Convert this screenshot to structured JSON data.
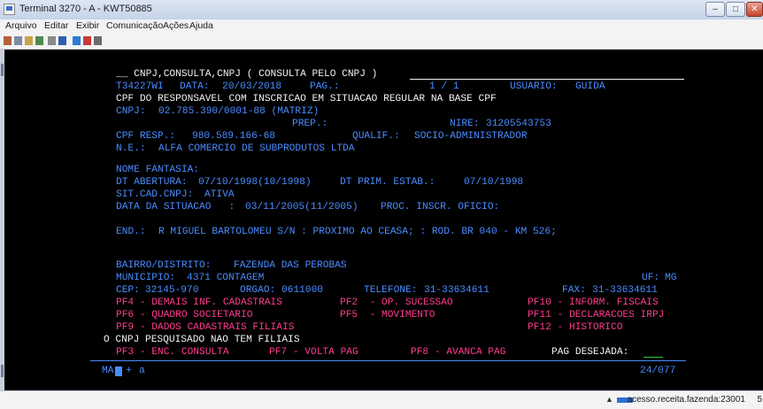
{
  "window": {
    "title": "Terminal 3270 - A - KWT50885",
    "min": "–",
    "max": "□",
    "close": "✕"
  },
  "menu": [
    "Arquivo",
    "Editar",
    "Exibir",
    "Comunicação",
    "Ações",
    "Ajuda"
  ],
  "toolbar_icons": [
    "new-session-icon",
    "copy-icon",
    "paste-icon",
    "print-icon",
    "settings-icon",
    "record-icon",
    "connect-icon",
    "disconnect-icon",
    "macro-icon"
  ],
  "terminal": {
    "header": "__ CNPJ,CONSULTA,CNPJ ( CONSULTA PELO CNPJ )",
    "trans": "T34227WI",
    "data_label": "DATA:",
    "data": "20/03/2018",
    "pag_label": "PAG.:",
    "pag": "1 / 1",
    "usuario_label": "USUARIO:",
    "usuario": "GUIDA",
    "msg": "CPF DO RESPONSAVEL COM INSCRICAO EM SITUACAO REGULAR NA BASE CPF",
    "cnpj_label": "CNPJ:",
    "cnpj": "02.785.390/0001-88 (MATRIZ)",
    "prep_label": "PREP.:",
    "nire_label": "NIRE:",
    "nire": "31205543753",
    "cpfresp_label": "CPF RESP.:",
    "cpfresp": "980.589.166-68",
    "qualif_label": "QUALIF.:",
    "qualif": "SOCIO-ADMINISTRADOR",
    "ne_label": "N.E.:",
    "ne": "ALFA COMERCIO DE SUBPRODUTOS LTDA",
    "fantasia_label": "NOME FANTASIA:",
    "abertura_label": "DT ABERTURA:",
    "abertura": "07/10/1998(10/1998)",
    "primestab_label": "DT PRIM. ESTAB.:",
    "primestab": "07/10/1998",
    "sitcad_label": "SIT.CAD.CNPJ:",
    "sitcad": "ATIVA",
    "datasit_label": "DATA DA SITUACAO   :",
    "datasit": "03/11/2005(11/2005)",
    "proc_label": "PROC. INSCR. OFICIO:",
    "end_label": "END.:",
    "end": "R MIGUEL BARTOLOMEU S/N : PROXIMO AO CEASA; : ROD. BR 040 - KM 526;",
    "bairro_label": "BAIRRO/DISTRITO:",
    "bairro": "FAZENDA DAS PEROBAS",
    "municipio_label": "MUNICIPIO:",
    "municipio": "4371 CONTAGEM",
    "uf_label": "UF:",
    "uf": "MG",
    "cep_label": "CEP:",
    "cep": "32145-970",
    "orgao_label": "ORGAO:",
    "orgao": "0611000",
    "telefone_label": "TELEFONE:",
    "telefone": "31-33634611",
    "fax_label": "FAX:",
    "fax": "31-33634611",
    "pf4": "PF4 - DEMAIS INF. CADASTRAIS",
    "pf2": "PF2  - OP. SUCESSAO",
    "pf10": "PF10 - INFORM. FISCAIS",
    "pf6": "PF6 - QUADRO SOCIETARIO",
    "pf5": "PF5  - MOVIMENTO",
    "pf11": "PF11 - DECLARACOES IRPJ",
    "pf9": "PF9 - DADOS CADASTRAIS FILIAIS",
    "pf12": "PF12 - HISTORICO",
    "filiais_msg": "O CNPJ PESQUISADO NAO TEM FILIAIS",
    "pf3": "PF3 - ENC. CONSULTA",
    "pf7": "PF7 - VOLTA PAG",
    "pf8": "PF8 - AVANCA PAG",
    "pagdesejada_label": "PAG DESEJADA:",
    "oia_left": "MA",
    "oia_plus": "+",
    "oia_a": "a",
    "oia_pos": "24/077"
  },
  "status": {
    "text": "acesso.receita.fazenda:23001",
    "extra": "5"
  }
}
